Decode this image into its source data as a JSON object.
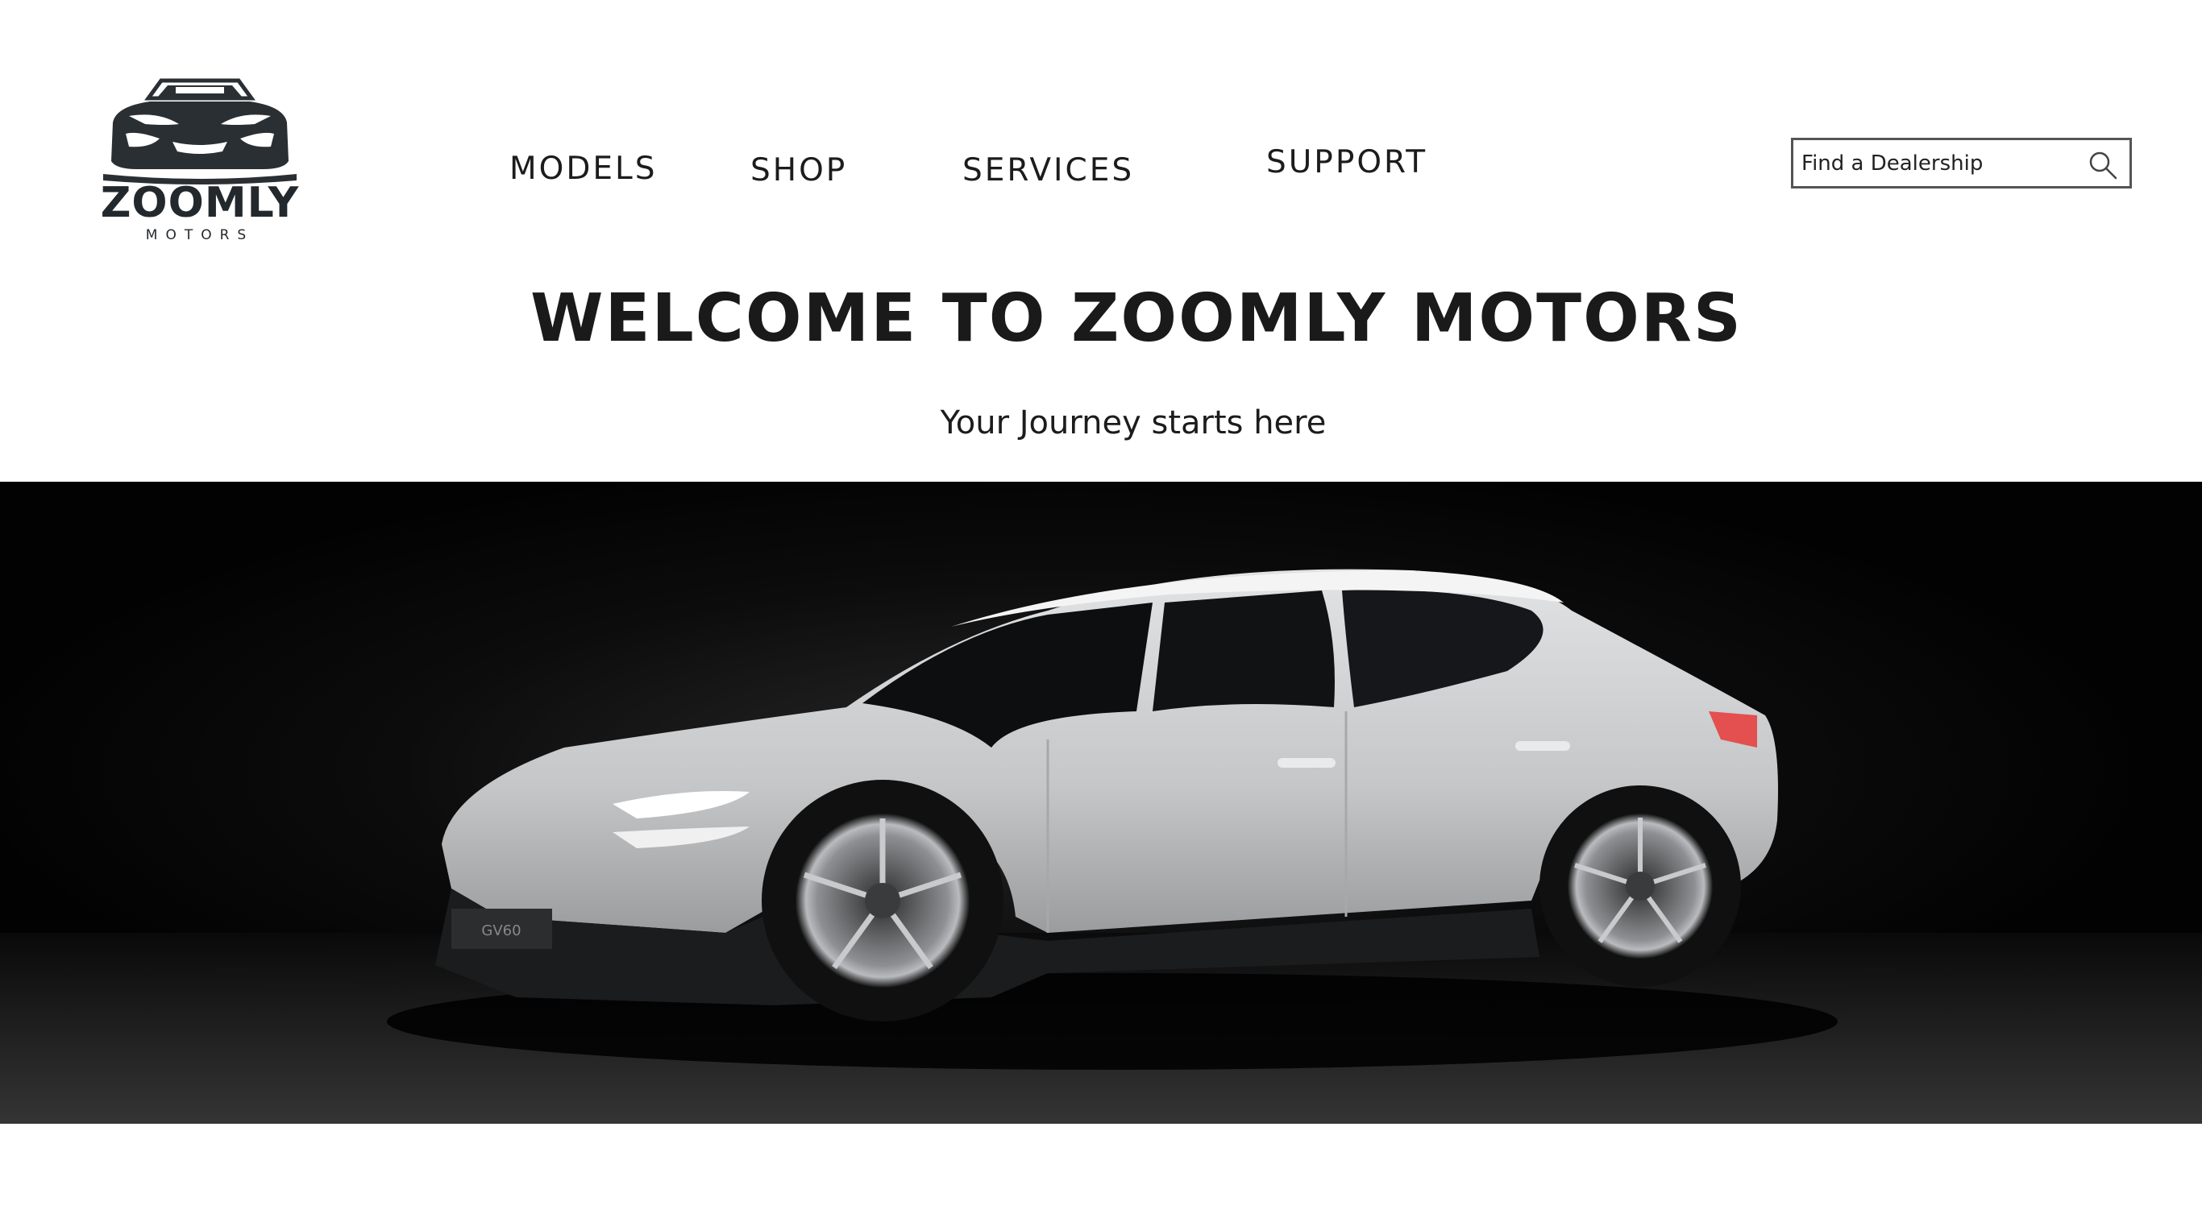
{
  "brand": {
    "name": "ZOOMLY",
    "tagline": "MOTORS",
    "logo_icon": "sports-car-front-icon"
  },
  "nav": {
    "items": [
      {
        "label": "MODELS"
      },
      {
        "label": "SHOP"
      },
      {
        "label": "SERVICES"
      },
      {
        "label": "SUPPORT"
      }
    ]
  },
  "search": {
    "placeholder": "Find a Dealership",
    "icon": "search-icon"
  },
  "hero": {
    "title": "WELCOME TO ZOOMLY MOTORS",
    "subtitle": "Your Journey starts here",
    "image": "silver-electric-crossover-suv-photo",
    "image_badge": "GV60"
  },
  "colors": {
    "text": "#1c1c1c",
    "background": "#ffffff",
    "hero_bg": "#020202",
    "car_body": "#c9cbcd"
  }
}
